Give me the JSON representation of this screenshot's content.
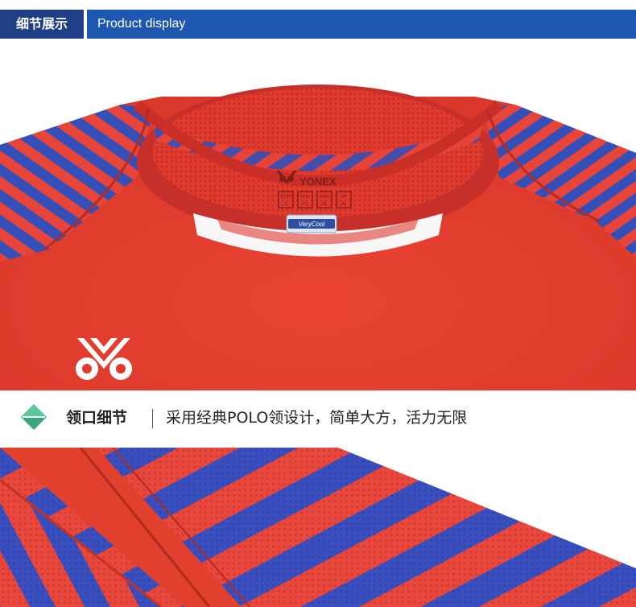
{
  "header": {
    "title_cn": "细节展示",
    "title_en": "Product display"
  },
  "collar_label": {
    "brand": "YONEX",
    "sizes": [
      "S",
      "XS",
      "M",
      "M"
    ],
    "regions": [
      "EUR",
      "USA",
      "ASIA",
      "JP"
    ],
    "tech_badge": "VeryCool"
  },
  "caption": {
    "title": "领口细节",
    "description": "采用经典POLO领设计，简单大方，活力无限",
    "icon": "diamond-icon"
  },
  "colors": {
    "header_blue": "#1e57b0",
    "header_dark": "#1f3f86",
    "shirt_red": "#e33a2c",
    "stripe_blue": "#3450b8",
    "icon_green": "#3aa87a"
  }
}
